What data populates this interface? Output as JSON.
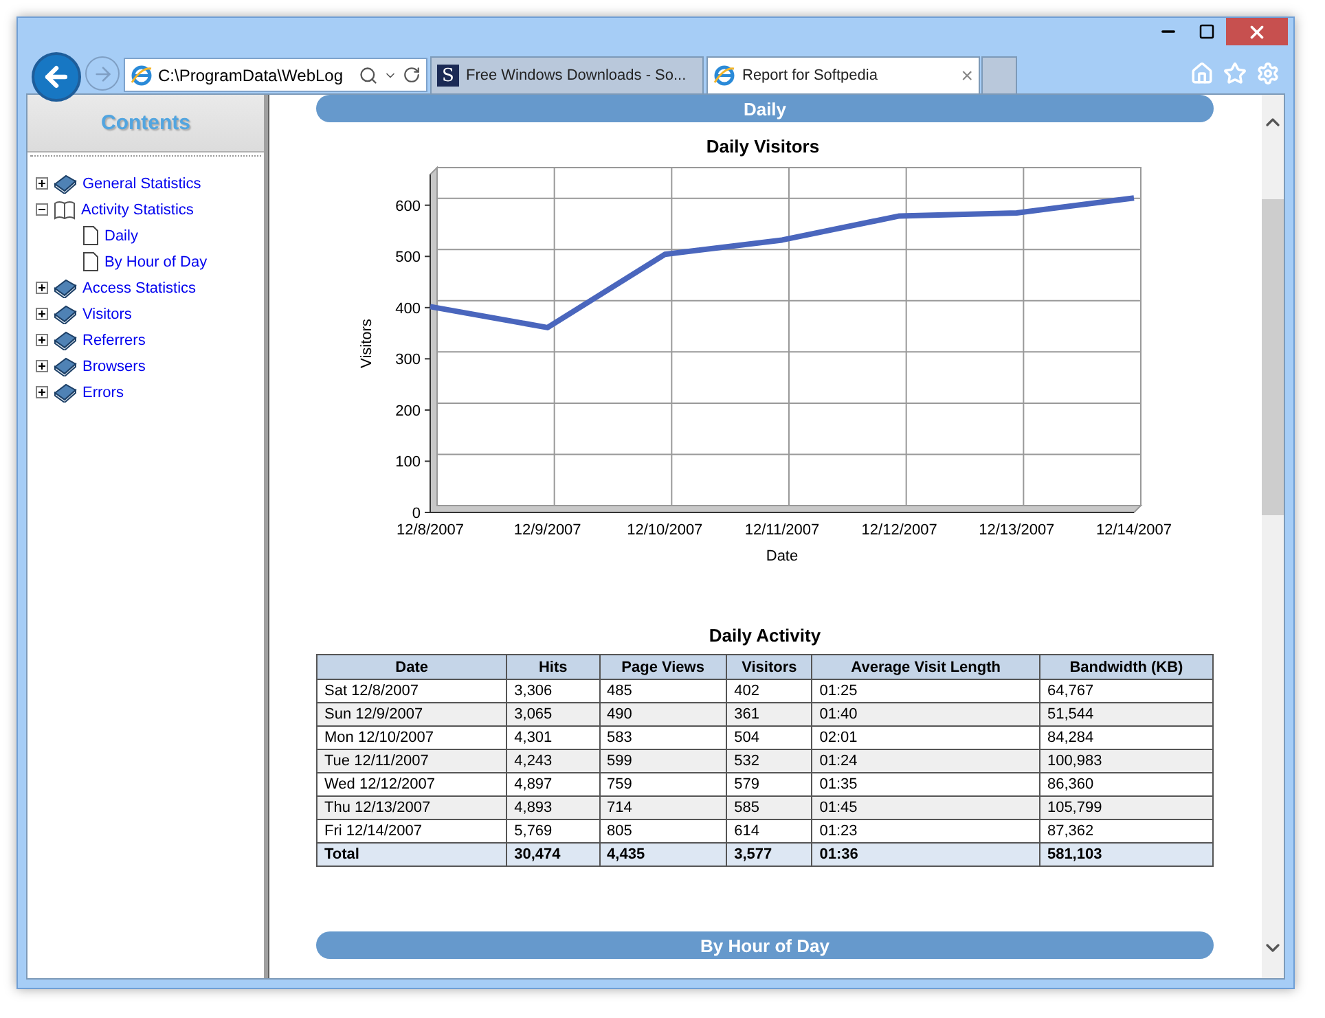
{
  "browser": {
    "address": "C:\\ProgramData\\WebLog",
    "tabs": [
      {
        "title": "Free Windows Downloads - So...",
        "selected": false,
        "kind": "softpedia",
        "letter": "S"
      },
      {
        "title": "Report for Softpedia",
        "selected": true,
        "kind": "ie",
        "close": "×"
      }
    ]
  },
  "sidebar": {
    "title": "Contents",
    "items": [
      {
        "label": "General Statistics",
        "expanded": false
      },
      {
        "label": "Activity Statistics",
        "expanded": true,
        "children": [
          {
            "label": "Daily"
          },
          {
            "label": "By Hour of Day"
          }
        ]
      },
      {
        "label": "Access Statistics",
        "expanded": false
      },
      {
        "label": "Visitors",
        "expanded": false
      },
      {
        "label": "Referrers",
        "expanded": false
      },
      {
        "label": "Browsers",
        "expanded": false
      },
      {
        "label": "Errors",
        "expanded": false
      }
    ]
  },
  "section": {
    "heading": "Daily",
    "chart_data": {
      "type": "line",
      "title": "Daily Visitors",
      "xlabel": "Date",
      "ylabel": "Visitors",
      "categories": [
        "12/8/2007",
        "12/9/2007",
        "12/10/2007",
        "12/11/2007",
        "12/12/2007",
        "12/13/2007",
        "12/14/2007"
      ],
      "series": [
        {
          "color": "#4a66bd",
          "values": [
            402,
            361,
            504,
            532,
            579,
            585,
            614
          ]
        }
      ],
      "ylim": [
        0,
        660
      ],
      "yticks": [
        0,
        100,
        200,
        300,
        400,
        500,
        600
      ]
    },
    "table_title": "Daily Activity",
    "table": {
      "columns": [
        "Date",
        "Hits",
        "Page Views",
        "Visitors",
        "Average Visit Length",
        "Bandwidth (KB)"
      ],
      "rows": [
        {
          "kind": "day",
          "cells": [
            "Sat 12/8/2007",
            "3,306",
            "485",
            "402",
            "01:25",
            "64,767"
          ]
        },
        {
          "kind": "day",
          "cells": [
            "Sun 12/9/2007",
            "3,065",
            "490",
            "361",
            "01:40",
            "51,544"
          ]
        },
        {
          "kind": "day",
          "cells": [
            "Mon 12/10/2007",
            "4,301",
            "583",
            "504",
            "02:01",
            "84,284"
          ]
        },
        {
          "kind": "day",
          "cells": [
            "Tue 12/11/2007",
            "4,243",
            "599",
            "532",
            "01:24",
            "100,983"
          ]
        },
        {
          "kind": "day",
          "cells": [
            "Wed 12/12/2007",
            "4,897",
            "759",
            "579",
            "01:35",
            "86,360"
          ]
        },
        {
          "kind": "day",
          "cells": [
            "Thu 12/13/2007",
            "4,893",
            "714",
            "585",
            "01:45",
            "105,799"
          ]
        },
        {
          "kind": "day",
          "cells": [
            "Fri 12/14/2007",
            "5,769",
            "805",
            "614",
            "01:23",
            "87,362"
          ]
        },
        {
          "kind": "total",
          "cells": [
            "Total",
            "30,474",
            "4,435",
            "3,577",
            "01:36",
            "581,103"
          ]
        }
      ]
    }
  },
  "next_section": {
    "heading": "By Hour of Day"
  }
}
